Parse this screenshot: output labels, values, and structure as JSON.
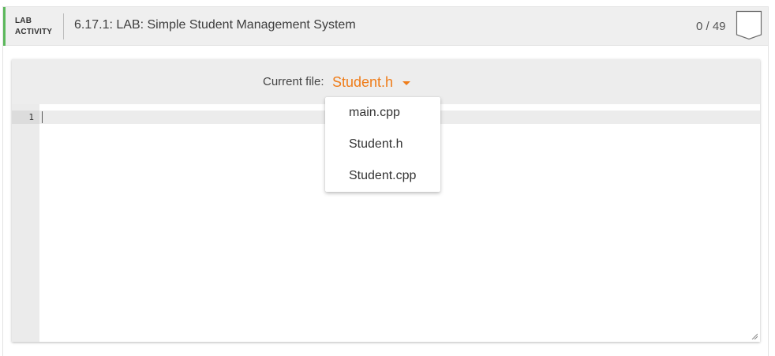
{
  "activity": {
    "type_line1": "LAB",
    "type_line2": "ACTIVITY",
    "title": "6.17.1: LAB: Simple Student Management System",
    "score": "0 / 49",
    "accent_color": "#5cb85c",
    "completion_icon": "badge-outline-icon"
  },
  "editor": {
    "current_file_label": "Current file:",
    "current_file": "Student.h",
    "accent_color": "#ef7d1a",
    "line_numbers": [
      "1"
    ],
    "dropdown_options": [
      "main.cpp",
      "Student.h",
      "Student.cpp"
    ]
  }
}
